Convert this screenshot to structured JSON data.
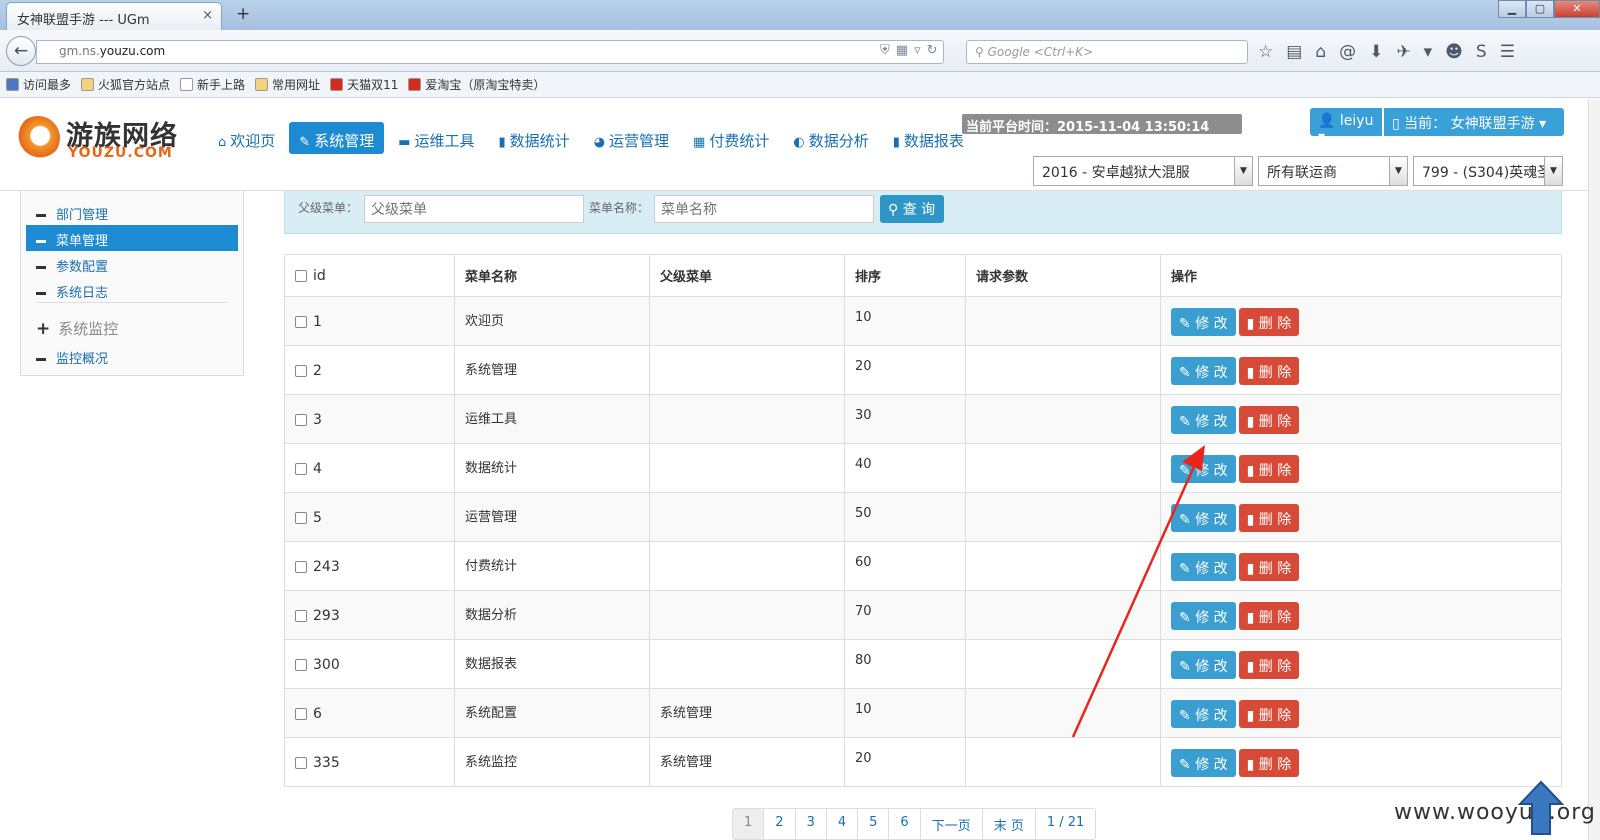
{
  "browser": {
    "tab_title": "女神联盟手游 --- UGm",
    "tab_close": "×",
    "new_tab": "+",
    "url_prefix": "gm.ns.",
    "url_host": "youzu.com",
    "search_placeholder": "Google <Ctrl+K>",
    "bookmarks": [
      {
        "label": "访问最多",
        "color": "#4a78c2"
      },
      {
        "label": "火狐官方站点",
        "color": "#f4d37a"
      },
      {
        "label": "新手上路",
        "color": "#ffffff"
      },
      {
        "label": "常用网址",
        "color": "#f4d37a"
      },
      {
        "label": "天猫双11",
        "color": "#d52b1e"
      },
      {
        "label": "爱淘宝（原淘宝特卖）",
        "color": "#d52b1e"
      }
    ]
  },
  "logo": {
    "cn": "游族网络",
    "en": "YOUZU.COM"
  },
  "nav": [
    {
      "label": "欢迎页",
      "icon": "home-icon",
      "glyph": "⌂",
      "active": false
    },
    {
      "label": "系统管理",
      "icon": "wrench-icon",
      "glyph": "✎",
      "active": true
    },
    {
      "label": "运维工具",
      "icon": "tool-icon",
      "glyph": "▬",
      "active": false
    },
    {
      "label": "数据统计",
      "icon": "bar-chart-icon",
      "glyph": "▮",
      "active": false
    },
    {
      "label": "运营管理",
      "icon": "globe-icon",
      "glyph": "◕",
      "active": false
    },
    {
      "label": "付费统计",
      "icon": "gift-icon",
      "glyph": "▦",
      "active": false
    },
    {
      "label": "数据分析",
      "icon": "contrast-icon",
      "glyph": "◐",
      "active": false
    },
    {
      "label": "数据报表",
      "icon": "book-icon",
      "glyph": "▮",
      "active": false
    }
  ],
  "header": {
    "server_time": "当前平台时间：2015-11-04 13:50:14 PRC",
    "user": "leiyu ▾",
    "current_game": "当前： 女神联盟手游 ▾",
    "select_platform": "2016 - 安卓越狱大混服",
    "select_operator": "所有联运商",
    "select_server": "799 - (S304)英魂圣"
  },
  "sidebar": {
    "items": [
      {
        "label": "部门管理",
        "active": false
      },
      {
        "label": "菜单管理",
        "active": true
      },
      {
        "label": "参数配置",
        "active": false
      },
      {
        "label": "系统日志",
        "active": false
      }
    ],
    "group_icon": "+",
    "group": "系统监控",
    "group_items": [
      {
        "label": "监控概况",
        "active": false
      }
    ]
  },
  "filter": {
    "parent_label": "父级菜单：",
    "parent_placeholder": "父级菜单",
    "name_label": "菜单名称：",
    "name_placeholder": "菜单名称",
    "query_button": "查 询"
  },
  "table": {
    "headers": [
      "id",
      "菜单名称",
      "父级菜单",
      "排序",
      "请求参数",
      "操作"
    ],
    "edit_label": "修 改",
    "delete_label": "删 除",
    "rows": [
      {
        "id": "1",
        "name": "欢迎页",
        "parent": "",
        "order": "10",
        "params": ""
      },
      {
        "id": "2",
        "name": "系统管理",
        "parent": "",
        "order": "20",
        "params": ""
      },
      {
        "id": "3",
        "name": "运维工具",
        "parent": "",
        "order": "30",
        "params": ""
      },
      {
        "id": "4",
        "name": "数据统计",
        "parent": "",
        "order": "40",
        "params": ""
      },
      {
        "id": "5",
        "name": "运营管理",
        "parent": "",
        "order": "50",
        "params": ""
      },
      {
        "id": "243",
        "name": "付费统计",
        "parent": "",
        "order": "60",
        "params": ""
      },
      {
        "id": "293",
        "name": "数据分析",
        "parent": "",
        "order": "70",
        "params": ""
      },
      {
        "id": "300",
        "name": "数据报表",
        "parent": "",
        "order": "80",
        "params": ""
      },
      {
        "id": "6",
        "name": "系统配置",
        "parent": "系统管理",
        "order": "10",
        "params": ""
      },
      {
        "id": "335",
        "name": "系统监控",
        "parent": "系统管理",
        "order": "20",
        "params": ""
      }
    ]
  },
  "pager": [
    "1",
    "2",
    "3",
    "4",
    "5",
    "6",
    "下一页",
    "末 页",
    "1 / 21"
  ],
  "watermark": "www.wooyun.org",
  "colors": {
    "primary": "#1d8bd1",
    "danger": "#d84a38",
    "annotation": "#e8271c"
  }
}
